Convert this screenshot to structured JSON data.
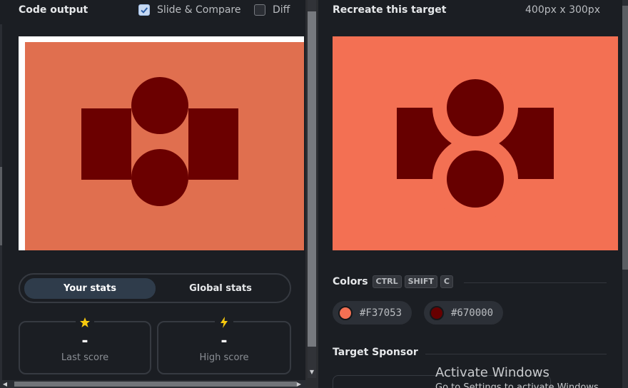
{
  "left_panel": {
    "title": "Code output",
    "slide_compare": {
      "label": "Slide & Compare",
      "checked": true
    },
    "diff": {
      "label": "Diff",
      "checked": false
    },
    "output_bg": "#e06f4f",
    "shape_color": "#6b0000",
    "tabs": {
      "your_stats": "Your stats",
      "global_stats": "Global stats",
      "active": "your_stats"
    },
    "stats": [
      {
        "icon": "star-icon",
        "value": "-",
        "label": "Last score",
        "icon_color": "#f6c90e"
      },
      {
        "icon": "bolt-icon",
        "value": "-",
        "label": "High score",
        "icon_color": "#f6c90e"
      }
    ]
  },
  "right_panel": {
    "title": "Recreate this target",
    "dimensions": "400px x 300px",
    "target_bg": "#f37053",
    "shape_color": "#670000",
    "colors_section": {
      "title": "Colors",
      "shortcut_keys": [
        "CTRL",
        "SHIFT",
        "C"
      ],
      "swatches": [
        {
          "hex": "#F37053",
          "color": "#F37053"
        },
        {
          "hex": "#670000",
          "color": "#670000"
        }
      ]
    },
    "sponsor_title": "Target Sponsor"
  },
  "os_watermark": {
    "line1": "Activate Windows",
    "line2": "Go to Settings to activate Windows."
  }
}
